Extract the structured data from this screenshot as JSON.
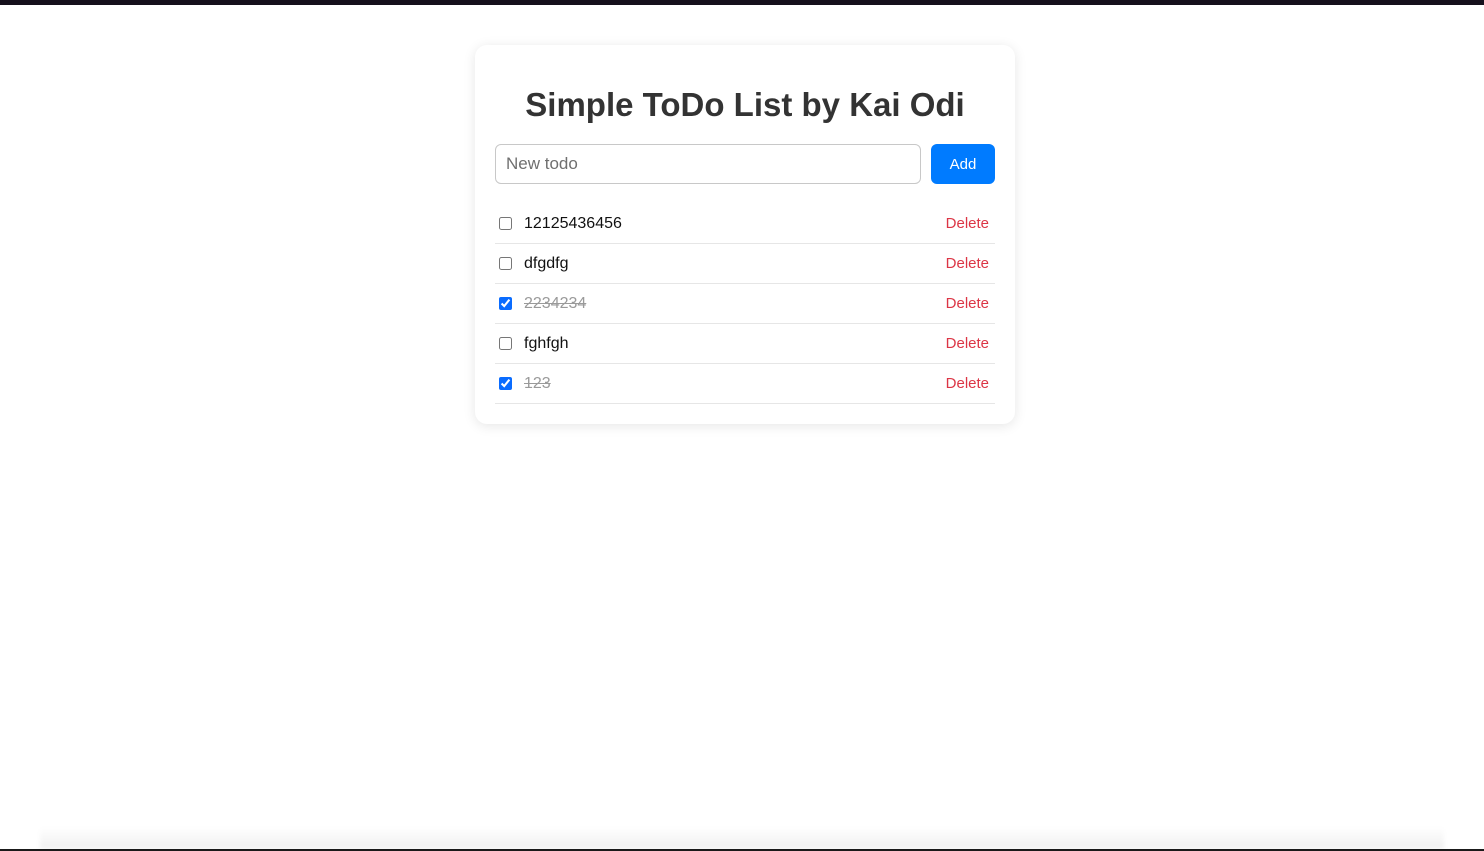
{
  "app": {
    "title": "Simple ToDo List by Kai Odi"
  },
  "new_todo": {
    "value": "",
    "placeholder": "New todo",
    "add_label": "Add"
  },
  "todos": [
    {
      "text": "12125436456",
      "done": false,
      "delete_label": "Delete"
    },
    {
      "text": "dfgdfg",
      "done": false,
      "delete_label": "Delete"
    },
    {
      "text": "2234234",
      "done": true,
      "delete_label": "Delete"
    },
    {
      "text": "fghfgh",
      "done": false,
      "delete_label": "Delete"
    },
    {
      "text": "123",
      "done": true,
      "delete_label": "Delete"
    }
  ],
  "colors": {
    "accent": "#007bff",
    "danger": "#dc3545",
    "title": "#333333",
    "done_text": "#9a9a9a"
  }
}
